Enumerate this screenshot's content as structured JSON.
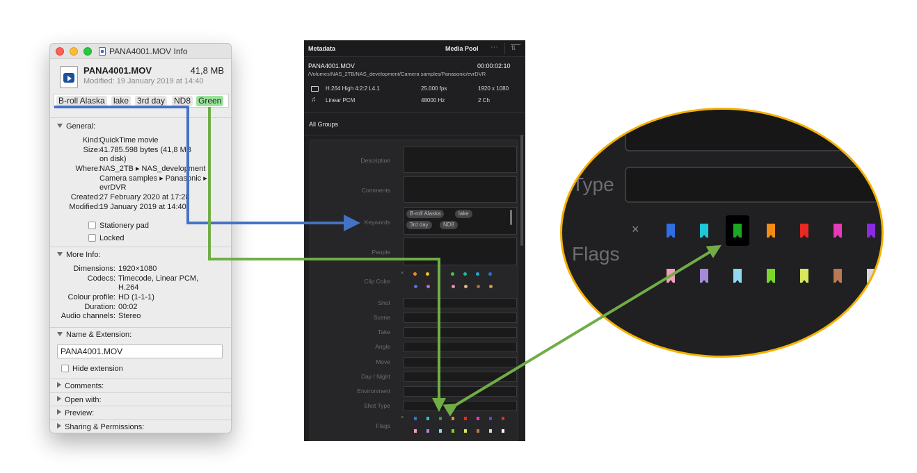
{
  "info_window": {
    "title": "PANA4001.MOV Info",
    "file_name": "PANA4001.MOV",
    "file_size": "41,8 MB",
    "modified": "Modified: 19 January 2019 at 14:40",
    "tags": [
      "B-roll Alaska",
      "lake",
      "3rd day",
      "ND8",
      "Green"
    ],
    "general": {
      "heading": "General:",
      "kind_label": "Kind:",
      "kind": "QuickTime movie",
      "size_label": "Size:",
      "size_1": "41.785.598 bytes (41,8 MB",
      "size_2": "on disk)",
      "where_label": "Where:",
      "where_1": "NAS_2TB ▸ NAS_development",
      "where_2": "Camera samples ▸ Panasonic ▸",
      "where_3": "evrDVR",
      "created_label": "Created:",
      "created": "27 February 2020 at 17:28",
      "modified_label": "Modified:",
      "modified": "19 January 2019 at 14:40",
      "stationery": "Stationery pad",
      "locked": "Locked"
    },
    "more_info": {
      "heading": "More Info:",
      "dimensions_label": "Dimensions:",
      "dimensions": "1920×1080",
      "codecs_label": "Codecs:",
      "codecs_1": "Timecode, Linear PCM,",
      "codecs_2": "H.264",
      "profile_label": "Colour profile:",
      "profile": "HD (1-1-1)",
      "duration_label": "Duration:",
      "duration": "00:02",
      "audio_label": "Audio channels:",
      "audio": "Stereo"
    },
    "name_ext": {
      "heading": "Name & Extension:",
      "value": "PANA4001.MOV",
      "hide_ext": "Hide extension"
    },
    "collapsed_sections": [
      "Comments:",
      "Open with:",
      "Preview:",
      "Sharing & Permissions:"
    ]
  },
  "resolve": {
    "tab_metadata": "Metadata",
    "tab_media_pool": "Media Pool",
    "more": "···",
    "clip_name": "PANA4001.MOV",
    "timecode": "00:00:02:10",
    "path": "/Volumes/NAS_2TB/NAS_development/Camera samples/Panasonic/evrDVR",
    "codec": "H.264 High 4:2:2 L4.1",
    "fps": "25.000 fps",
    "resolution": "1920 x 1080",
    "audio_codec": "Linear PCM",
    "sample_rate": "48000 Hz",
    "channels": "2 Ch",
    "group_title": "All Groups",
    "fields": [
      "Description",
      "Comments",
      "Keywords",
      "People",
      "Clip Color",
      "Shot",
      "Scene",
      "Take",
      "Angle",
      "Move",
      "Day / Night",
      "Environment",
      "Shot Type",
      "Flags"
    ],
    "keywords": [
      "B-roll Alaska",
      "lake",
      "3rd day",
      "ND8"
    ],
    "clear_mark": "×"
  },
  "zoom": {
    "type_label": "Type",
    "flags_label": "Flags",
    "clear_mark": "×"
  },
  "colors": {
    "flag_row1": [
      "#2f6fe0",
      "#1fc6d8",
      "#19a824",
      "#f08c17",
      "#e62a23",
      "#e83ab6",
      "#8a2be2"
    ],
    "flag_row2": [
      "#f0a0b8",
      "#a48ad8",
      "#8fd8f0",
      "#7bd62a",
      "#d8e85a",
      "#b87a52",
      "#d8d8d8"
    ],
    "clip_color_row1": [
      "#f28a1a",
      "#f2c21a",
      "#4cc24c",
      "#1fb89a",
      "#1aa8d8",
      "#2a6fe0"
    ],
    "clip_color_row2": [
      "#5a6fd8",
      "#b86ad8",
      "#f08ab0",
      "#d8b88a",
      "#a4722a",
      "#c8a23a"
    ],
    "arrow_blue": "#4472c4",
    "arrow_green": "#70ad47",
    "zoom_border": "#f6b100"
  }
}
